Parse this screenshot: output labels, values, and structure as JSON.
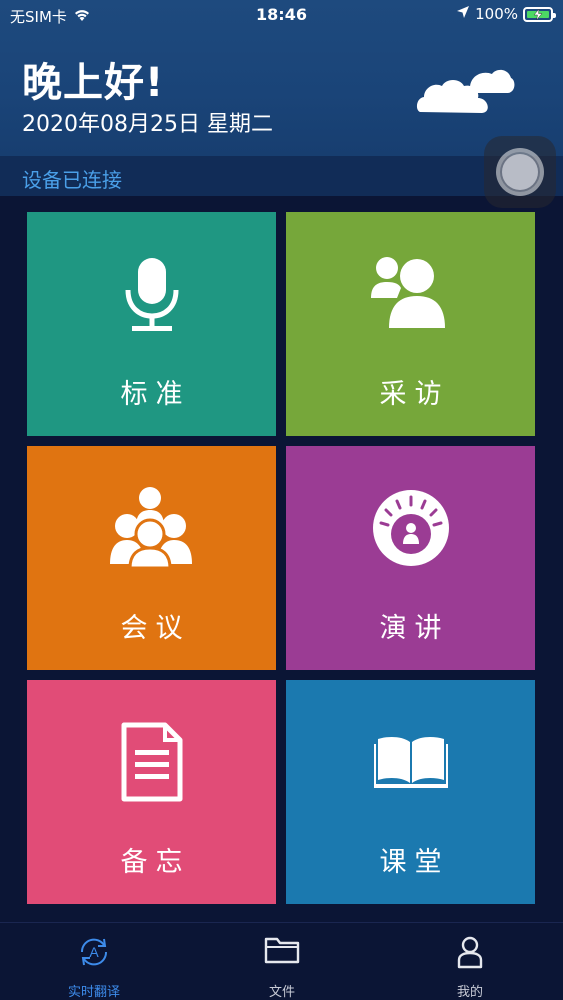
{
  "status_bar": {
    "carrier": "无SIM卡",
    "time": "18:46",
    "battery": "100%",
    "icons": [
      "wifi-icon",
      "location-arrow-icon",
      "battery-charging-icon"
    ]
  },
  "header": {
    "greeting": "晚上好!",
    "date": "2020年08月25日 星期二",
    "icon": "cloud-icon"
  },
  "connection": {
    "status": "设备已连接"
  },
  "modes": [
    {
      "label": "标准",
      "icon": "microphone-icon",
      "color": "#1f9782"
    },
    {
      "label": "采访",
      "icon": "two-people-icon",
      "color": "#76a73a"
    },
    {
      "label": "会议",
      "icon": "group-icon",
      "color": "#e07411"
    },
    {
      "label": "演讲",
      "icon": "speaker-podium-icon",
      "color": "#9b3c94"
    },
    {
      "label": "备忘",
      "icon": "document-icon",
      "color": "#e14c77"
    },
    {
      "label": "课堂",
      "icon": "open-book-icon",
      "color": "#1b79af"
    }
  ],
  "tabbar": {
    "tabs": [
      {
        "label": "实时翻译",
        "icon": "translate-icon",
        "active": true
      },
      {
        "label": "文件",
        "icon": "folder-icon",
        "active": false
      },
      {
        "label": "我的",
        "icon": "person-icon",
        "active": false
      }
    ],
    "active_color": "#3d8bea"
  }
}
